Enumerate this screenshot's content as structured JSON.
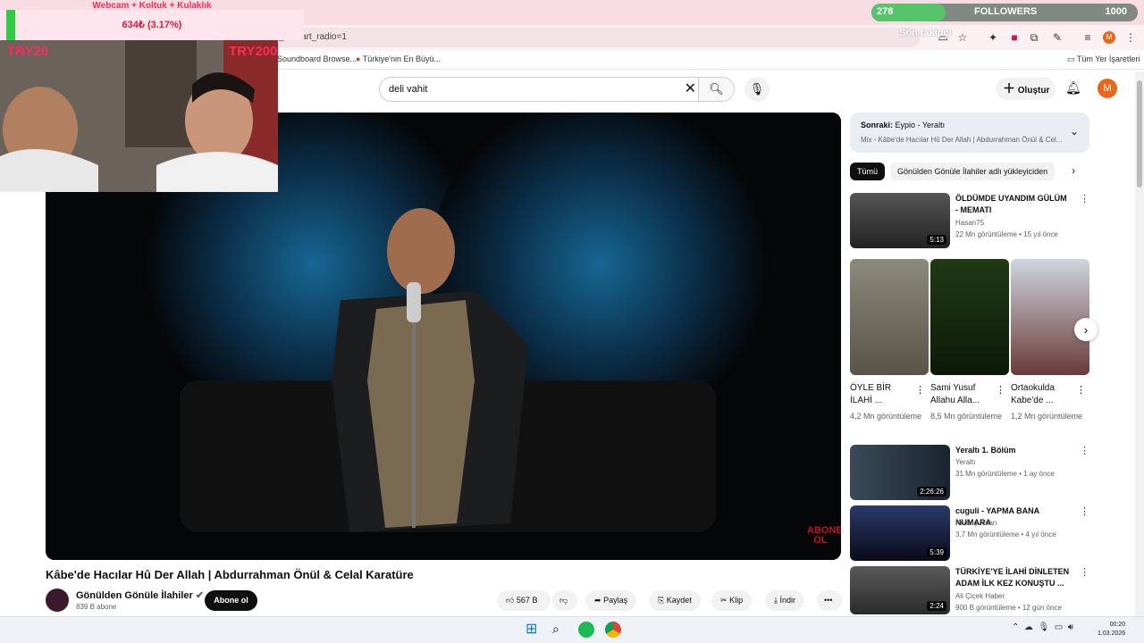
{
  "browser": {
    "tab_title": "Webcam + Koltuk + Kulaklık",
    "url_fragment": "_k&start_radio=1",
    "bookmarks": [
      {
        "label": "Soundboard Browse..."
      },
      {
        "label": "Türkiye'nin En Büyü..."
      }
    ],
    "bookmarks_right": "Tüm Yer İşaretleri"
  },
  "stream_overlay": {
    "goal_title": "Webcam + Koltuk + Kulaklık",
    "goal_progress": "634₺ (3.17%)",
    "goal_progress_fraction": 0.0317,
    "left_tag": "TRY20",
    "right_tag": "TRY20000",
    "followers_current": "278",
    "followers_label": "FOLLOWERS",
    "followers_goal": "1000",
    "followers_fraction": 0.278,
    "followers_sub": "Son takipçi"
  },
  "youtube": {
    "search_value": "deli vahit",
    "create_label": "Oluştur",
    "avatar_letter": "M",
    "video_title": "Kâbe'de Hacılar Hû Der Allah | Abdurrahman Önül & Celal Karatüre",
    "watermark": "ABONE OL",
    "channel_name": "Gönülden Gönüle İlahiler",
    "channel_subs": "839 B abone",
    "subscribe_label": "Abone ol",
    "like_count": "567 B",
    "share_label": "Paylaş",
    "save_label": "Kaydet",
    "clip_label": "Klip",
    "download_label": "İndir",
    "up_next_prefix": "Sonraki:",
    "up_next_title": "Eypio - Yeraltı",
    "mix_title": "Mix - Kâbe'de Hacılar Hû Der Allah | Abdurrahman Önül & Cel...",
    "chips": [
      "Tümü",
      "Gönülden Gönüle İlahiler adlı yükleyiciden"
    ],
    "related": [
      {
        "title": "ÖLDÜMDE UYANDIM GÜLÜM - MEMATI",
        "channel": "Hasan75",
        "meta": "22 Mn görüntüleme • 15 yıl önce",
        "duration": "5:13"
      },
      {
        "title": "Yeraltı 1. Bölüm",
        "channel": "Yeraltı",
        "meta": "31 Mn görüntüleme • 1 ay önce",
        "duration": "2:26:26"
      },
      {
        "title": "cuguli - YAPMA BANA NUMARA",
        "channel": "Kıvanç Aslan",
        "meta": "3,7 Mn görüntüleme • 4 yıl önce",
        "duration": "5:39"
      },
      {
        "title": "TÜRKİYE'YE İLAHİ DİNLETEN ADAM İLK KEZ KONUŞTU ...",
        "channel": "Ali Çiçek Haber",
        "meta": "900 B görüntüleme • 12 gün önce",
        "duration": "2:24"
      }
    ],
    "shorts": [
      {
        "title": "ÖYLE BİR İLAHİ ...",
        "views": "4,2 Mn görüntüleme"
      },
      {
        "title": "Sami Yusuf Allahu Alla...",
        "views": "8,5 Mn görüntüleme"
      },
      {
        "title": "Ortaokulda Kabe'de ...",
        "views": "1,2 Mn görüntüleme"
      }
    ]
  },
  "taskbar": {
    "time": "00:20",
    "date": "1.03.2026"
  },
  "colors": {
    "accent_red": "#ff0000",
    "overlay_pink": "#ff2a5a",
    "avatar_orange": "#e8671a",
    "followers_green": "#57c46c"
  }
}
